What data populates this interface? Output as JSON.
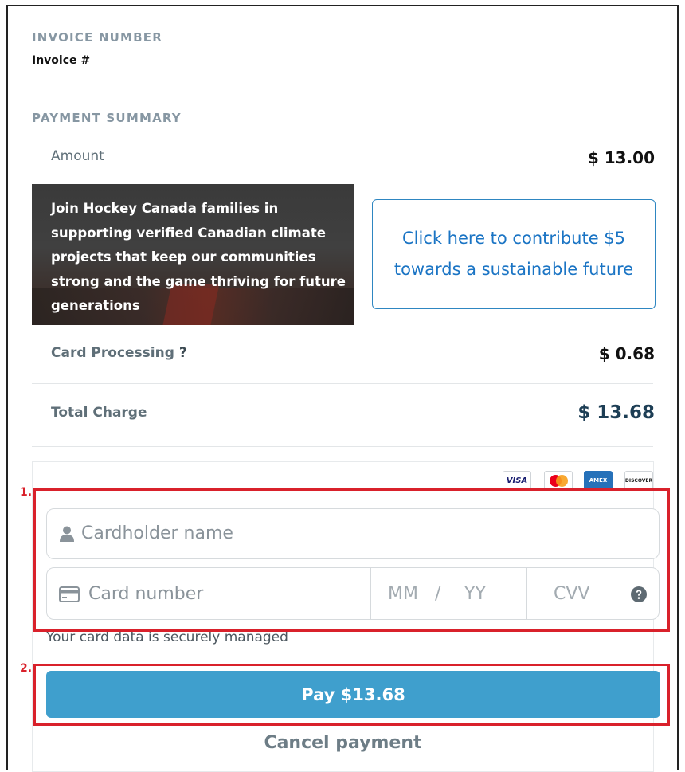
{
  "invoice": {
    "section_label": "INVOICE NUMBER",
    "value": "Invoice #"
  },
  "summary": {
    "section_label": "PAYMENT SUMMARY",
    "amount_label": "Amount",
    "amount_value": "$ 13.00",
    "promo_text": "Join Hockey Canada families in supporting verified Canadian climate projects that keep our communities strong and the game thriving for future generations",
    "contribute_button": "Click here to contribute $5 towards a sustainable future",
    "processing_label": "Card Processing",
    "processing_help": "?",
    "processing_value": "$ 0.68",
    "total_label": "Total Charge",
    "total_value": "$ 13.68"
  },
  "card_brands": [
    "VISA",
    "Mastercard",
    "AMEX",
    "DISCOVER"
  ],
  "payment_form": {
    "cardholder_placeholder": "Cardholder name",
    "card_number_placeholder": "Card number",
    "expiry_month_placeholder": "MM",
    "expiry_sep": "/",
    "expiry_year_placeholder": "YY",
    "cvv_placeholder": "CVV",
    "secure_note": "Your card data is securely managed",
    "pay_button": "Pay $13.68",
    "cancel_link": "Cancel payment"
  },
  "annotations": {
    "marker_1": "1.",
    "marker_2": "2."
  },
  "colors": {
    "pay_button": "#3f9fcd",
    "highlight": "#d9212b",
    "link_blue": "#1a74c4",
    "total_value": "#1d3e55"
  }
}
